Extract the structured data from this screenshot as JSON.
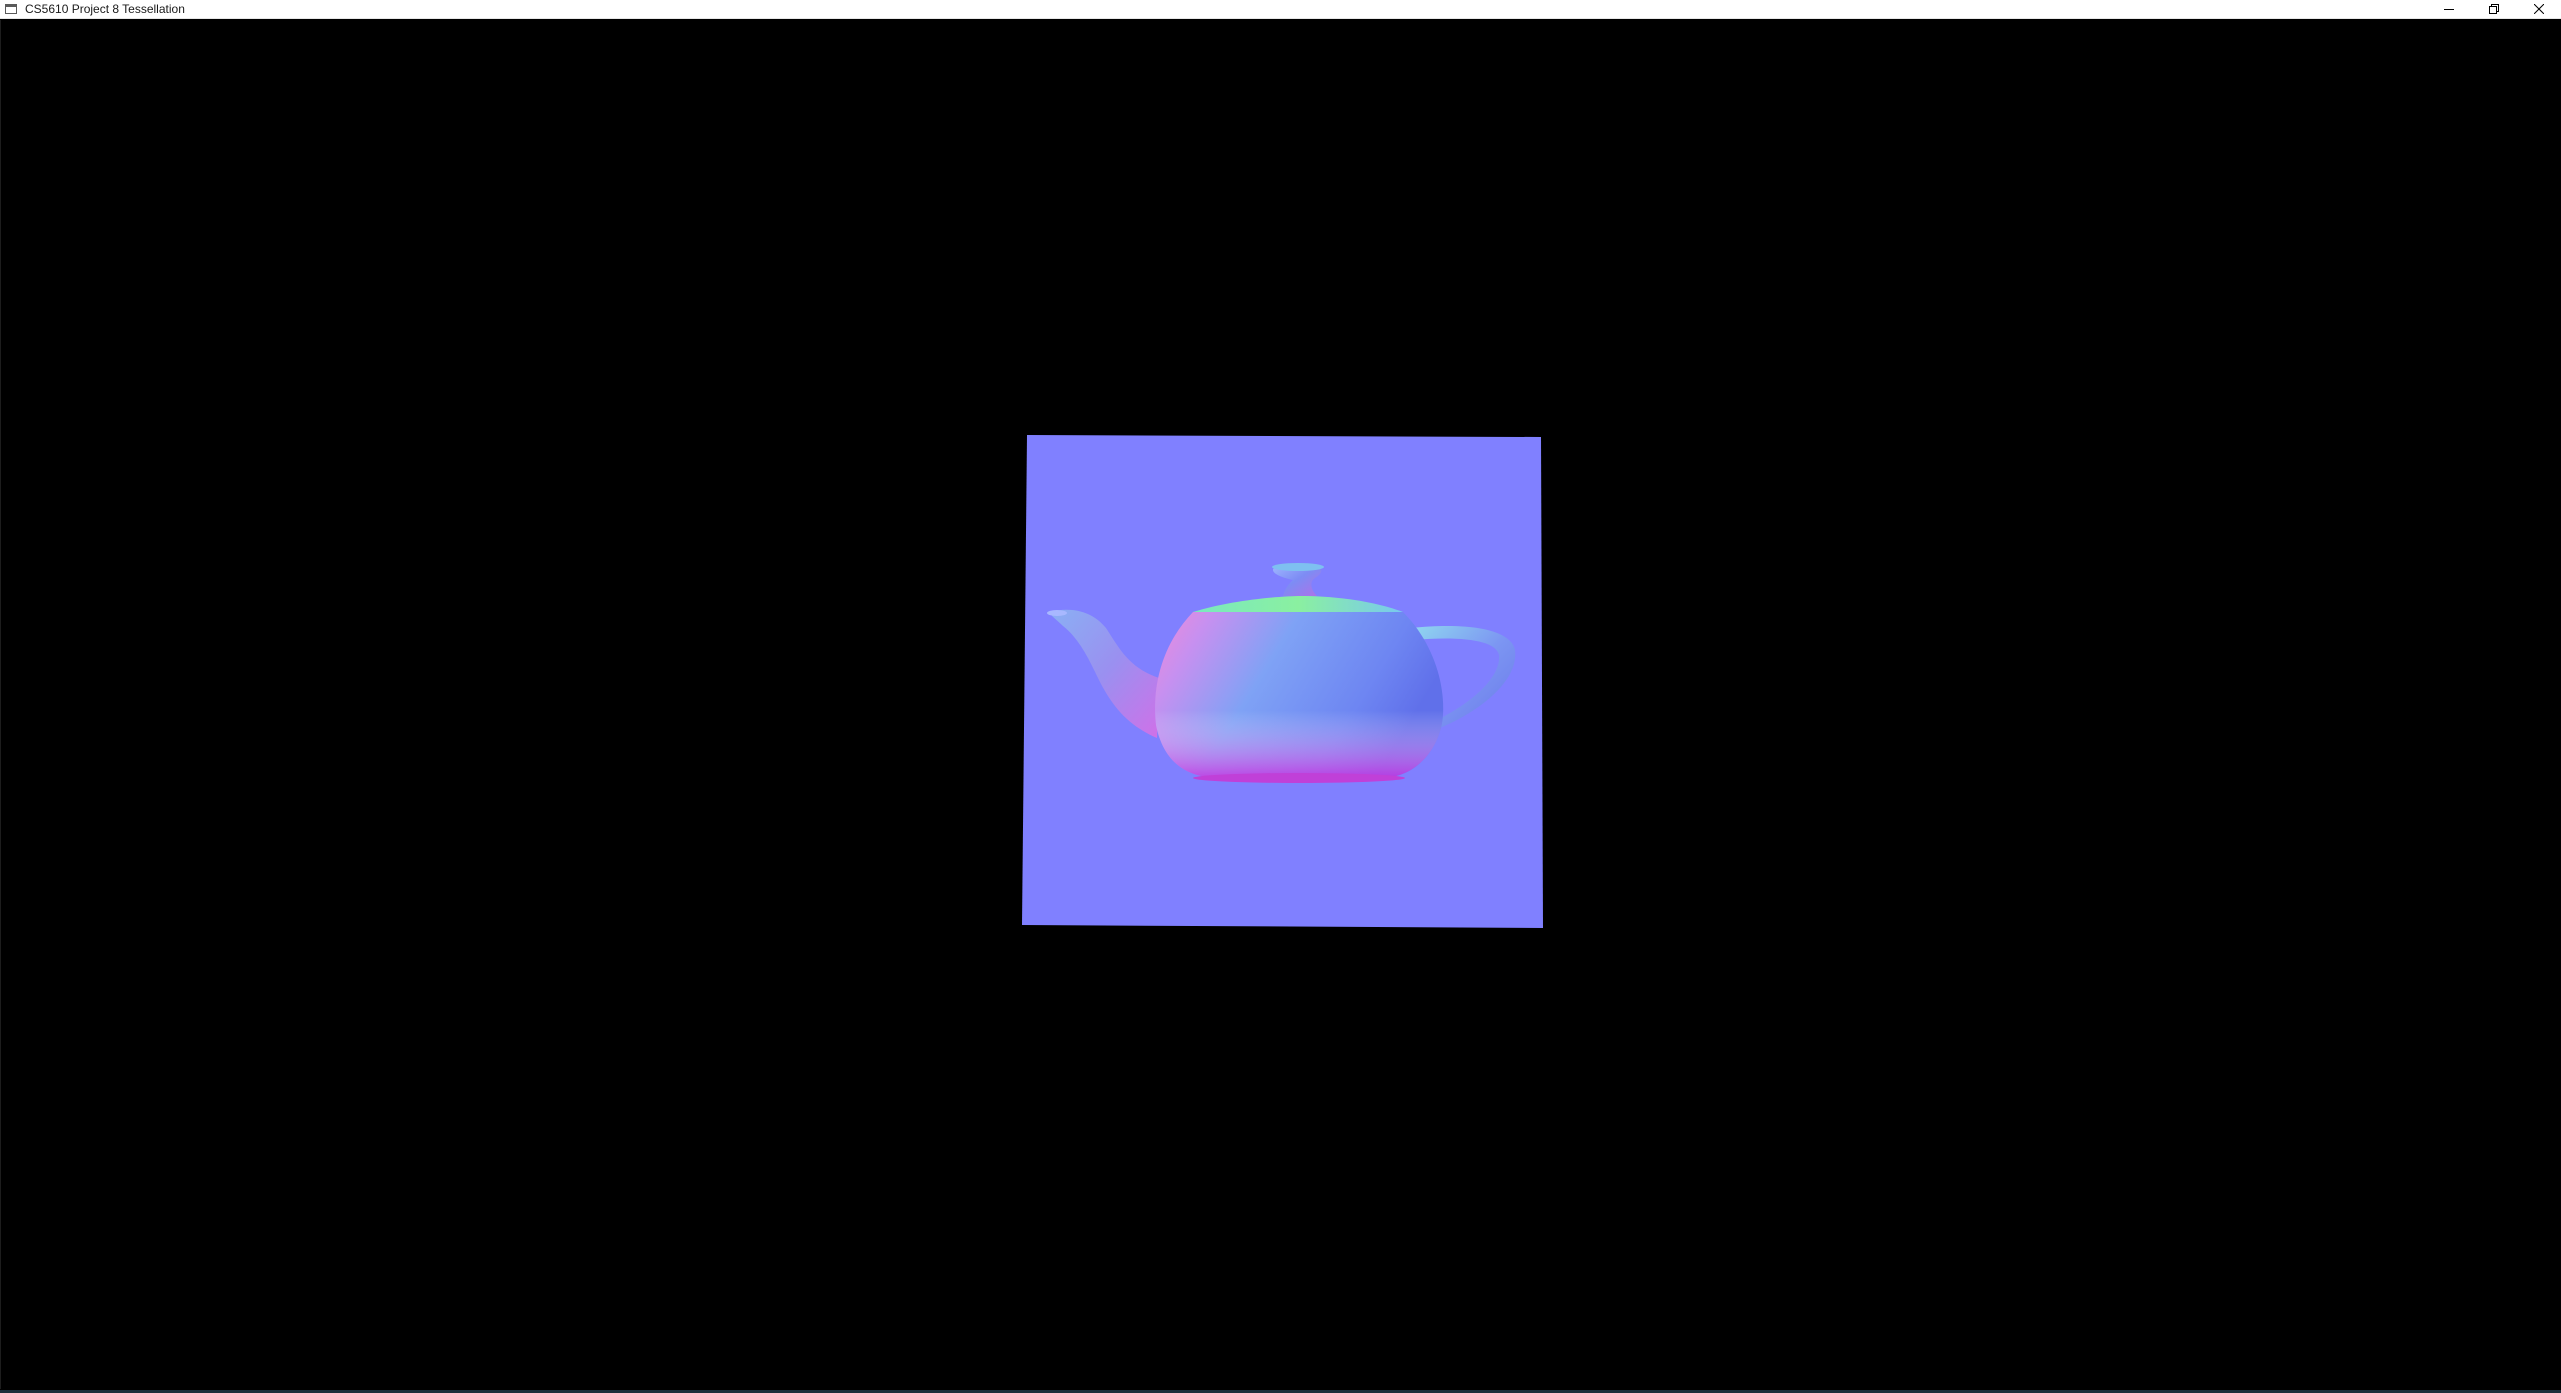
{
  "window": {
    "title": "CS5610 Project 8 Tessellation",
    "controls": [
      "minimize",
      "restore",
      "close"
    ]
  },
  "viewport": {
    "background_color": "#000000",
    "quad_color": "#8080ff",
    "object": "teapot-normal-map"
  },
  "icons": {
    "app": "app-window-icon",
    "minimize": "minimize-icon",
    "restore": "restore-icon",
    "close": "close-icon"
  }
}
